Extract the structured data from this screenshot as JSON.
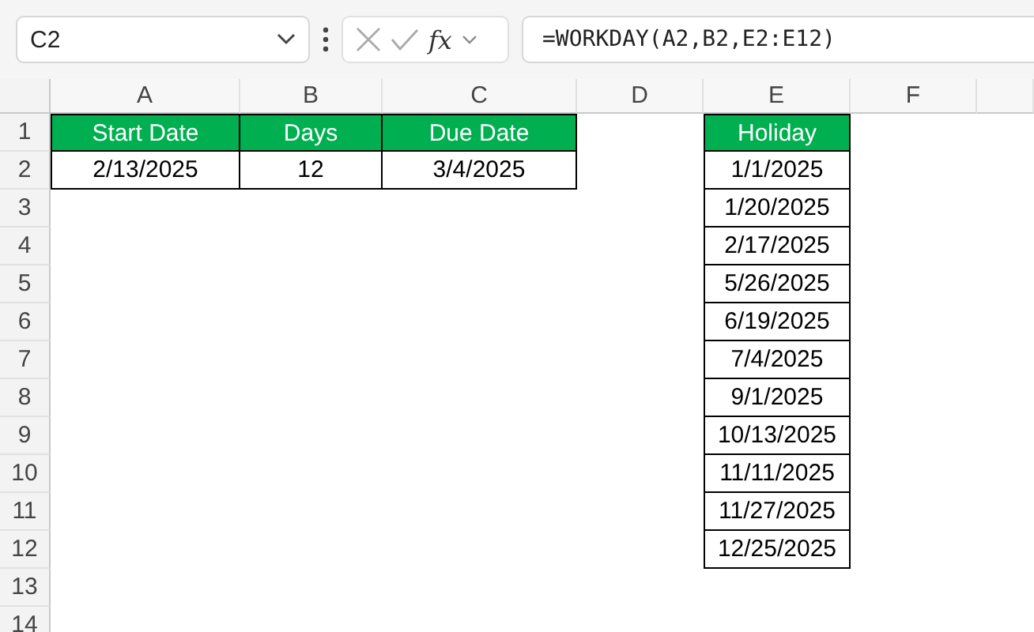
{
  "name_box": {
    "value": "C2"
  },
  "formula_bar": {
    "function_label": "fx",
    "formula": "=WORKDAY(A2,B2,E2:E12)"
  },
  "column_headers": [
    "A",
    "B",
    "C",
    "D",
    "E",
    "F"
  ],
  "row_headers": [
    "1",
    "2",
    "3",
    "4",
    "5",
    "6",
    "7",
    "8",
    "9",
    "10",
    "11",
    "12",
    "13",
    "14"
  ],
  "table": {
    "headers": [
      "Start Date",
      "Days",
      "Due Date"
    ],
    "rows": [
      [
        "2/13/2025",
        "12",
        "3/4/2025"
      ]
    ]
  },
  "holidays": {
    "header": "Holiday",
    "values": [
      "1/1/2025",
      "1/20/2025",
      "2/17/2025",
      "5/26/2025",
      "6/19/2025",
      "7/4/2025",
      "9/1/2025",
      "10/13/2025",
      "11/11/2025",
      "11/27/2025",
      "12/25/2025"
    ]
  }
}
